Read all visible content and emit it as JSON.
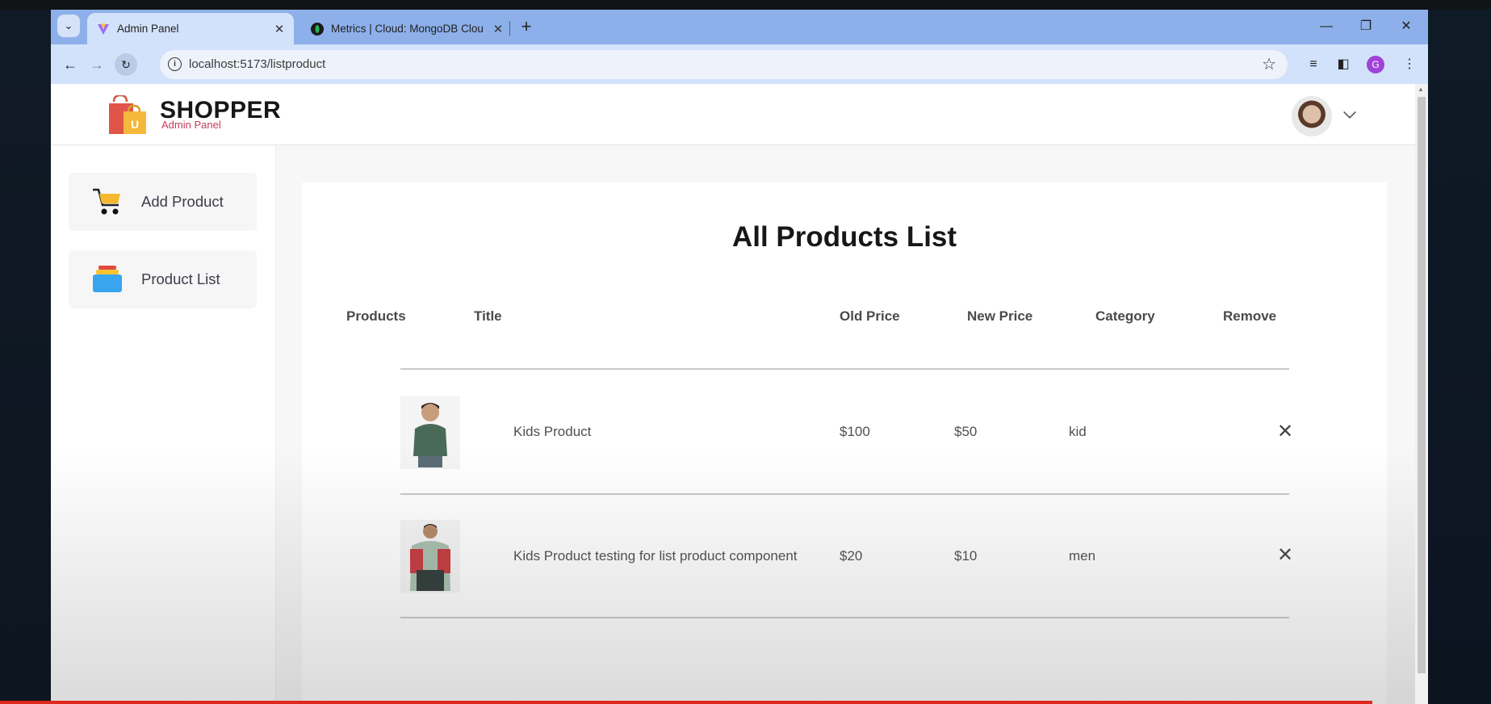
{
  "browser": {
    "tabs": [
      {
        "title": "Admin Panel",
        "active": true
      },
      {
        "title": "Metrics | Cloud: MongoDB Clou",
        "active": false
      }
    ],
    "url": "localhost:5173/listproduct",
    "profile_initial": "G"
  },
  "navbar": {
    "brand": "SHOPPER",
    "brand_sub": "Admin Panel"
  },
  "sidebar": {
    "items": [
      {
        "label": "Add Product"
      },
      {
        "label": "Product List"
      }
    ]
  },
  "main": {
    "title": "All Products List",
    "columns": [
      "Products",
      "Title",
      "Old Price",
      "New Price",
      "Category",
      "Remove"
    ],
    "rows": [
      {
        "title": "Kids Product",
        "old_price": "$100",
        "new_price": "$50",
        "category": "kid"
      },
      {
        "title": "Kids Product testing for list product component",
        "old_price": "$20",
        "new_price": "$10",
        "category": "men"
      }
    ]
  },
  "colors": {
    "tab_strip": "#8db0ea",
    "toolbar": "#d3e2fb",
    "brand_sub": "#c33a5d",
    "progress_bar": "#e1261c"
  }
}
